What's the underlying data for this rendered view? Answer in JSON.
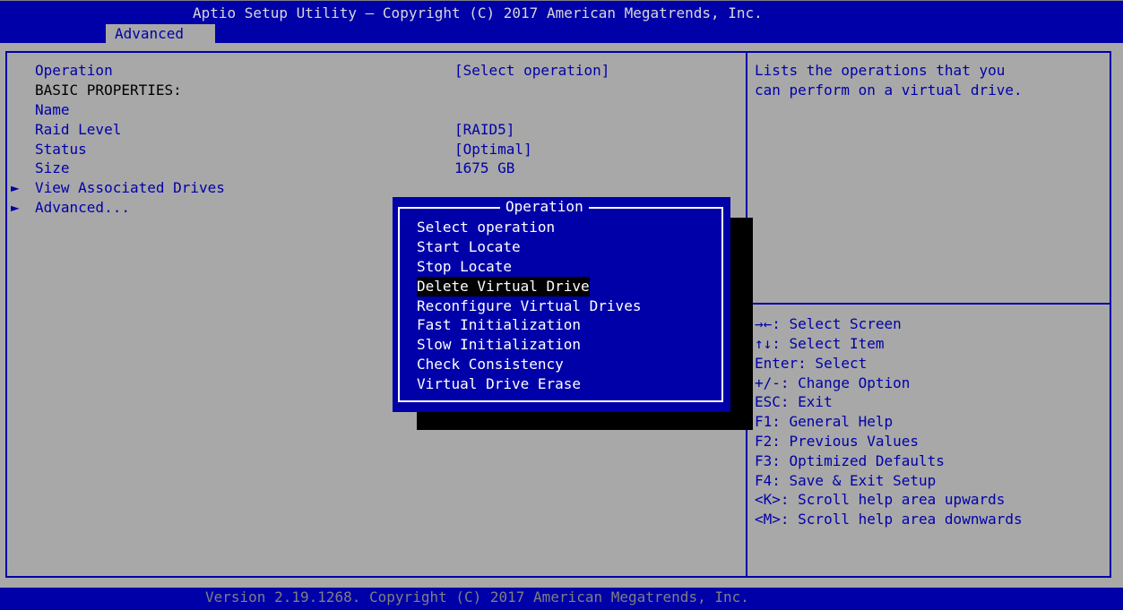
{
  "header": {
    "title": "Aptio Setup Utility – Copyright (C) 2017 American Megatrends, Inc.",
    "active_tab": "Advanced"
  },
  "settings": {
    "operation": {
      "label": "Operation",
      "value": "[Select operation]"
    },
    "basic_properties": "BASIC PROPERTIES:",
    "name": {
      "label": "Name"
    },
    "raid_level": {
      "label": "Raid Level",
      "value": "[RAID5]"
    },
    "status": {
      "label": "Status",
      "value": "[Optimal]"
    },
    "size": {
      "label": "Size",
      "value": "1675 GB"
    },
    "submenus": [
      {
        "arrow": "►",
        "label": "View Associated Drives"
      },
      {
        "arrow": "►",
        "label": "Advanced..."
      }
    ]
  },
  "help": {
    "description_lines": [
      "Lists the operations that you",
      "can perform on a virtual drive."
    ],
    "keys": [
      "→←: Select Screen",
      "↑↓: Select Item",
      "Enter: Select",
      "+/-: Change Option",
      "ESC: Exit",
      "F1: General Help",
      "F2: Previous Values",
      "F3: Optimized Defaults",
      "F4: Save & Exit Setup",
      "<K>: Scroll help area upwards",
      "<M>: Scroll help area downwards"
    ]
  },
  "popup": {
    "title": "Operation",
    "options": [
      "Select operation",
      "Start Locate",
      "Stop Locate",
      "Delete Virtual Drive",
      "Reconfigure Virtual Drives",
      "Fast Initialization",
      "Slow Initialization",
      "Check Consistency",
      "Virtual Drive Erase"
    ],
    "selected": "Delete Virtual Drive"
  },
  "footer": {
    "text": "Version 2.19.1268. Copyright (C) 2017 American Megatrends, Inc."
  },
  "colors": {
    "bios_blue": "#0000a8",
    "panel_gray": "#a8a8a8",
    "highlight_black": "#000000",
    "text_white": "#ffffff"
  }
}
